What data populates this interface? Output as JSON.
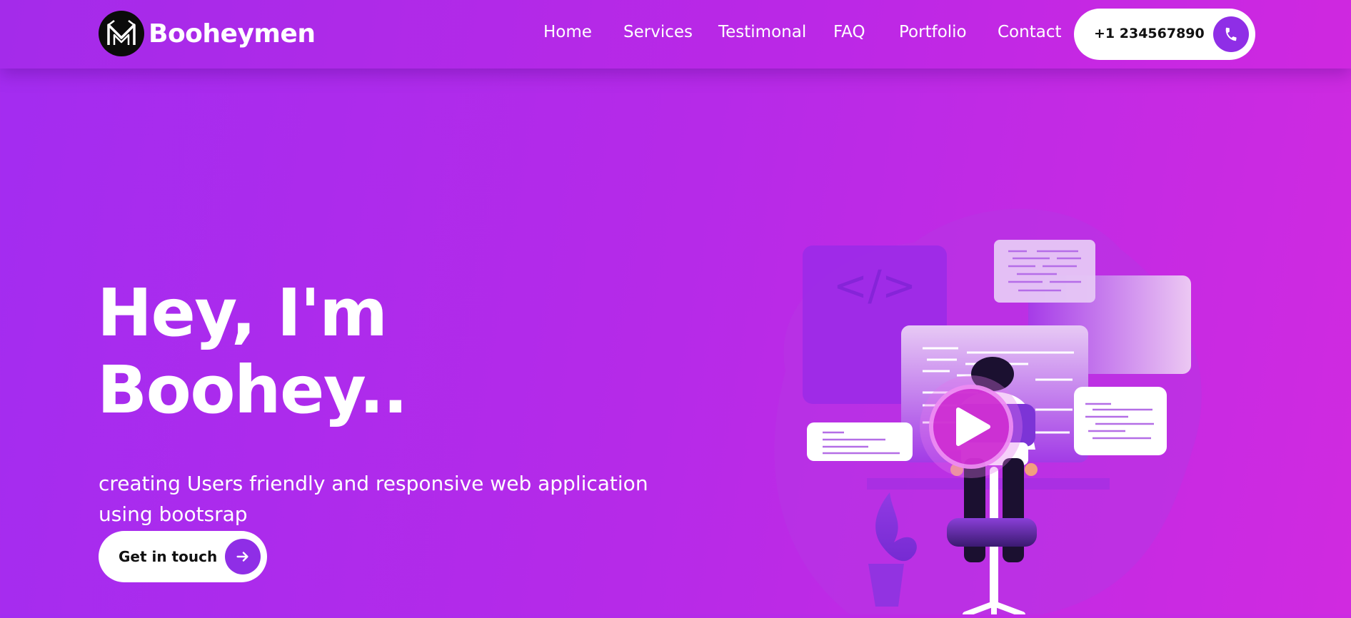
{
  "brand": {
    "name": "Booheymen",
    "logo_icon": "monogram-m-logo"
  },
  "nav": {
    "items": [
      {
        "label": "Home"
      },
      {
        "label": "Services"
      },
      {
        "label": "Testimonal"
      },
      {
        "label": "FAQ"
      },
      {
        "label": "Portfolio"
      },
      {
        "label": "Contact"
      }
    ]
  },
  "phone": {
    "number": "+1 234567890",
    "icon": "phone-icon"
  },
  "hero": {
    "heading_line1": "Hey, I'm",
    "heading_line2": "Boohey..",
    "subtitle": "creating Users friendly and responsive web application using bootsrap",
    "cta_label": "Get in touch",
    "cta_icon": "arrow-right-icon"
  },
  "illustration": {
    "code_symbol": "</>",
    "play_icon": "play-icon"
  },
  "colors": {
    "background_start": "#a32cf0",
    "background_end": "#d02ae0",
    "accent": "#8f2ee6",
    "button_bg": "#ffffff",
    "play_button": "#d12fd6",
    "text_dark": "#111111"
  }
}
